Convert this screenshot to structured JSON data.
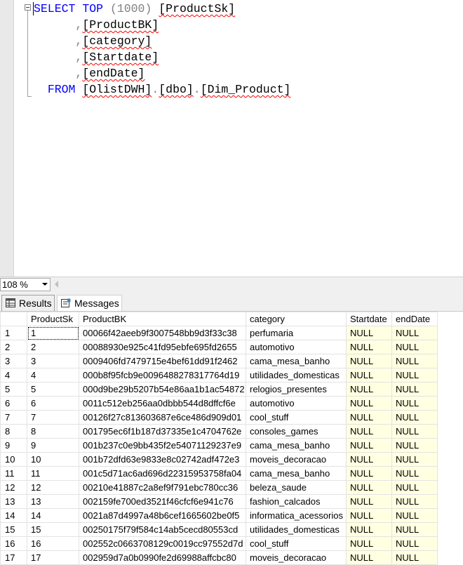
{
  "editor": {
    "lines": [
      {
        "parts": [
          {
            "t": "SELECT",
            "c": "kw"
          },
          {
            "t": " "
          },
          {
            "t": "TOP",
            "c": "kw"
          },
          {
            "t": " (1000) ",
            "c": "gray"
          },
          {
            "t": "[ProductSk]",
            "c": "sq"
          }
        ]
      },
      {
        "parts": [
          {
            "t": "      ,",
            "c": "gray"
          },
          {
            "t": "[ProductBK]",
            "c": "sq"
          }
        ]
      },
      {
        "parts": [
          {
            "t": "      ,",
            "c": "gray"
          },
          {
            "t": "[category]",
            "c": "sq"
          }
        ]
      },
      {
        "parts": [
          {
            "t": "      ,",
            "c": "gray"
          },
          {
            "t": "[Startdate]",
            "c": "sq"
          }
        ]
      },
      {
        "parts": [
          {
            "t": "      ,",
            "c": "gray"
          },
          {
            "t": "[endDate]",
            "c": "sq"
          }
        ]
      },
      {
        "parts": [
          {
            "t": "  "
          },
          {
            "t": "FROM",
            "c": "kw"
          },
          {
            "t": " "
          },
          {
            "t": "[OlistDWH]",
            "c": "sq"
          },
          {
            "t": ".",
            "c": "gray"
          },
          {
            "t": "[dbo]",
            "c": "sq"
          },
          {
            "t": ".",
            "c": "gray"
          },
          {
            "t": "[Dim_Product]",
            "c": "sq"
          }
        ]
      }
    ]
  },
  "zoom": {
    "value": "108 %"
  },
  "tabs": {
    "results": "Results",
    "messages": "Messages"
  },
  "grid": {
    "columns": [
      "ProductSk",
      "ProductBK",
      "category",
      "Startdate",
      "endDate"
    ],
    "rows": [
      [
        "1",
        "1",
        "00066f42aeeb9f3007548bb9d3f33c38",
        "perfumaria",
        "NULL",
        "NULL"
      ],
      [
        "2",
        "2",
        "00088930e925c41fd95ebfe695fd2655",
        "automotivo",
        "NULL",
        "NULL"
      ],
      [
        "3",
        "3",
        "0009406fd7479715e4bef61dd91f2462",
        "cama_mesa_banho",
        "NULL",
        "NULL"
      ],
      [
        "4",
        "4",
        "000b8f95fcb9e0096488278317764d19",
        "utilidades_domesticas",
        "NULL",
        "NULL"
      ],
      [
        "5",
        "5",
        "000d9be29b5207b54e86aa1b1ac54872",
        "relogios_presentes",
        "NULL",
        "NULL"
      ],
      [
        "6",
        "6",
        "0011c512eb256aa0dbbb544d8dffcf6e",
        "automotivo",
        "NULL",
        "NULL"
      ],
      [
        "7",
        "7",
        "00126f27c813603687e6ce486d909d01",
        "cool_stuff",
        "NULL",
        "NULL"
      ],
      [
        "8",
        "8",
        "001795ec6f1b187d37335e1c4704762e",
        "consoles_games",
        "NULL",
        "NULL"
      ],
      [
        "9",
        "9",
        "001b237c0e9bb435f2e54071129237e9",
        "cama_mesa_banho",
        "NULL",
        "NULL"
      ],
      [
        "10",
        "10",
        "001b72dfd63e9833e8c02742adf472e3",
        "moveis_decoracao",
        "NULL",
        "NULL"
      ],
      [
        "11",
        "11",
        "001c5d71ac6ad696d22315953758fa04",
        "cama_mesa_banho",
        "NULL",
        "NULL"
      ],
      [
        "12",
        "12",
        "00210e41887c2a8ef9f791ebc780cc36",
        "beleza_saude",
        "NULL",
        "NULL"
      ],
      [
        "13",
        "13",
        "002159fe700ed3521f46cfcf6e941c76",
        "fashion_calcados",
        "NULL",
        "NULL"
      ],
      [
        "14",
        "14",
        "0021a87d4997a48b6cef1665602be0f5",
        "informatica_acessorios",
        "NULL",
        "NULL"
      ],
      [
        "15",
        "15",
        "00250175f79f584c14ab5cecd80553cd",
        "utilidades_domesticas",
        "NULL",
        "NULL"
      ],
      [
        "16",
        "16",
        "002552c0663708129c0019cc97552d7d",
        "cool_stuff",
        "NULL",
        "NULL"
      ],
      [
        "17",
        "17",
        "002959d7a0b0990fe2d69988affcbc80",
        "moveis_decoracao",
        "NULL",
        "NULL"
      ]
    ]
  }
}
